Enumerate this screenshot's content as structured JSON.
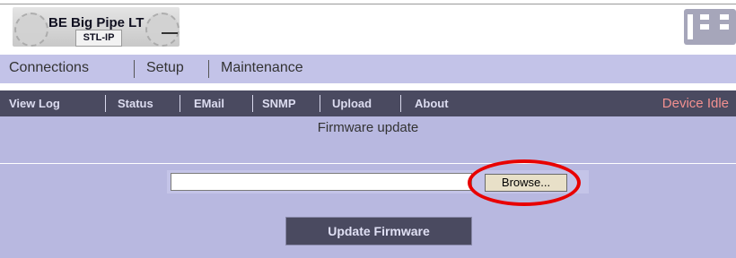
{
  "header": {
    "product_title": "BE Big Pipe LT",
    "product_subtitle": "STL-IP"
  },
  "main_nav": {
    "items": [
      "Connections",
      "Setup",
      "Maintenance"
    ]
  },
  "sub_nav": {
    "items": [
      "View Log",
      "Status",
      "EMail",
      "SNMP",
      "Upload",
      "About"
    ],
    "status": "Device Idle"
  },
  "firmware": {
    "title": "Firmware update",
    "file_value": "",
    "browse_label": "Browse...",
    "update_label": "Update Firmware",
    "highlight_color": "#e80000"
  }
}
